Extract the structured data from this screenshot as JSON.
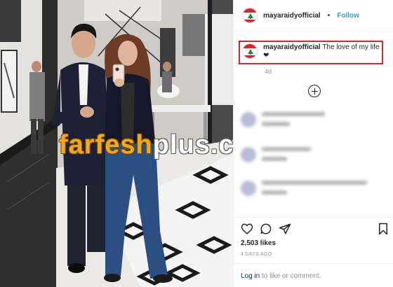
{
  "post": {
    "username": "mayaraidyofficial",
    "follow_label": "Follow",
    "separator": "•",
    "caption_user": "mayaraidyofficial",
    "caption_text": "The love of my life",
    "caption_emoji": "❤",
    "time_short": "4d",
    "likes": "2,503 likes",
    "time_long": "4 DAYS AGO",
    "login_link": "Log in",
    "login_rest": "to like or comment."
  },
  "watermark": {
    "part1": "farfesh",
    "part2": "plus.com"
  },
  "icons": {
    "avatar": "lebanon-flag-icon",
    "add": "add-comments-icon",
    "like": "heart-icon",
    "comment": "comment-icon",
    "share": "share-icon",
    "save": "bookmark-icon"
  },
  "colors": {
    "accent": "#3897f0",
    "highlight_box": "#d8262c",
    "link": "#003569",
    "muted": "#8e8e8e",
    "watermark_orange": "#f2a81d"
  }
}
